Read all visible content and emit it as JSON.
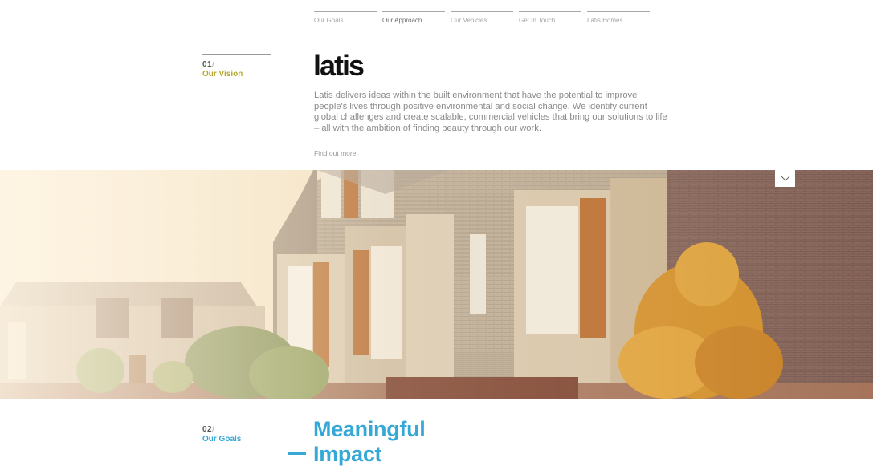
{
  "nav": {
    "items": [
      {
        "label": "Our Goals",
        "active": false
      },
      {
        "label": "Our Approach",
        "active": true
      },
      {
        "label": "Our Vehicles",
        "active": false
      },
      {
        "label": "Get In Touch",
        "active": false
      },
      {
        "label": "Latis Homes",
        "active": false
      }
    ]
  },
  "section1": {
    "number": "01",
    "slash": "/",
    "name": "Our Vision"
  },
  "logo": "latis",
  "intro": {
    "text": "Latis delivers ideas within the built environment that have the potential to improve people's lives through positive environmental and social change. We identify current global challenges and create scalable, commercial vehicles that bring our solutions to life – all with the ambition of finding beauty through our work.",
    "more_link": "Find out more"
  },
  "hero": {
    "scroll_icon": "chevron-down-icon"
  },
  "section2": {
    "number": "02",
    "slash": "/",
    "name": "Our Goals"
  },
  "headline": {
    "line1": "Meaningful",
    "line2": "Impact"
  },
  "colors": {
    "vision": "#b5a930",
    "goals": "#35a8d6",
    "text": "#8a8a8a"
  }
}
